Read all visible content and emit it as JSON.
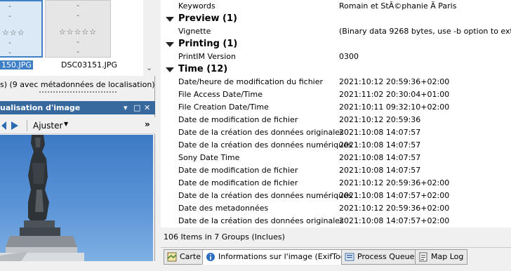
{
  "left": {
    "thumb1": {
      "dashes": [
        "-",
        "-",
        "-",
        "-"
      ],
      "stars": "☆☆☆",
      "filename": "150.JPG"
    },
    "thumb2": {
      "dashes": [
        "-",
        "-",
        "-",
        "-"
      ],
      "stars": "☆☆☆☆☆",
      "filename": "DSC03151.JPG"
    },
    "status_text": "s) (9 avec métadonnées de localisation) - 1",
    "viz_panel": {
      "title": "ualisation d'image",
      "pin_glyph": "▾",
      "restore_glyph": "□",
      "close_glyph": "✕",
      "adjust_label": "Ajuster",
      "more_glyph": "»"
    }
  },
  "right": {
    "rows": [
      {
        "type": "row",
        "k": "Keywords",
        "v": "Romain et StÃ©phanie Ã  Paris"
      },
      {
        "type": "group",
        "label": "Preview (1)"
      },
      {
        "type": "row",
        "k": "Vignette",
        "v": "(Binary data 9268 bytes, use -b option to extr..."
      },
      {
        "type": "group",
        "label": "Printing (1)"
      },
      {
        "type": "row",
        "k": "PrintIM Version",
        "v": "0300"
      },
      {
        "type": "group",
        "label": "Time (12)"
      },
      {
        "type": "row",
        "k": "Date/heure de modification du fichier",
        "v": "2021:10:12 20:59:36+02:00"
      },
      {
        "type": "row",
        "k": "File Access Date/Time",
        "v": "2021:11:02 20:30:04+01:00"
      },
      {
        "type": "row",
        "k": "File Creation Date/Time",
        "v": "2021:10:11 09:32:10+02:00"
      },
      {
        "type": "row",
        "k": "Date de modification de fichier",
        "v": "2021:10:12 20:59:36"
      },
      {
        "type": "row",
        "k": "Date de la création des données originales",
        "v": "2021:10:08 14:07:57"
      },
      {
        "type": "row",
        "k": "Date de la création des données numériques",
        "v": "2021:10:08 14:07:57"
      },
      {
        "type": "row",
        "k": "Sony Date Time",
        "v": "2021:10:08 14:07:57"
      },
      {
        "type": "row",
        "k": "Date de modification de fichier",
        "v": "2021:10:08 14:07:57"
      },
      {
        "type": "row",
        "k": "Date de modification de fichier",
        "v": "2021:10:12 20:59:36+02:00"
      },
      {
        "type": "row",
        "k": "Date de la création des données numériques",
        "v": "2021:10:08 14:07:57+02:00"
      },
      {
        "type": "row",
        "k": "Date des metadonnées",
        "v": "2021:10:12 20:59:36+02:00"
      },
      {
        "type": "row",
        "k": "Date de la création des données originales",
        "v": "2021:10:08 14:07:57+02:00"
      }
    ],
    "summary": "106 Items in 7 Groups   (Inclues)",
    "tabs": [
      {
        "label": "Carte",
        "icon": "map-icon"
      },
      {
        "label": "Informations sur l'image (ExifTool)",
        "icon": "info-icon"
      },
      {
        "label": "Process Queue",
        "icon": "queue-icon"
      },
      {
        "label": "Map Log",
        "icon": "log-icon"
      }
    ]
  },
  "colors": {
    "selection_blue": "#3f7fc5",
    "panel_title_blue": "#37699e",
    "sky_blue": "#4f88d0"
  }
}
